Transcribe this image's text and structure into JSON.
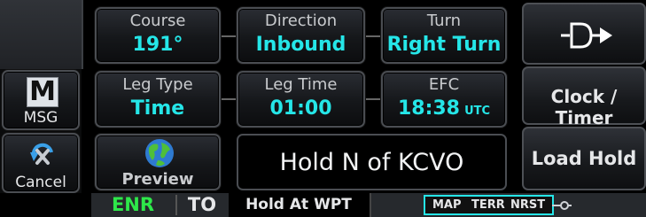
{
  "left_keys": {
    "msg": {
      "icon_letter": "M",
      "label": "MSG"
    },
    "cancel": {
      "label": "Cancel"
    }
  },
  "course": {
    "label": "Course",
    "value": "191°"
  },
  "direction": {
    "label": "Direction",
    "value": "Inbound"
  },
  "turn": {
    "label": "Turn",
    "value": "Right Turn"
  },
  "leg_type": {
    "label": "Leg Type",
    "value": "Time"
  },
  "leg_time": {
    "label": "Leg Time",
    "value": "01:00"
  },
  "efc": {
    "label": "EFC",
    "value": "18:38",
    "unit": "UTC"
  },
  "preview": {
    "label": "Preview"
  },
  "hold_display": {
    "text": "Hold N of KCVO"
  },
  "right_keys": {
    "clock_timer": "Clock / Timer",
    "load_hold": "Load Hold"
  },
  "status_bar": {
    "phase": "ENR",
    "to": "TO",
    "hold_at": "Hold At WPT",
    "map": "MAP",
    "terr": "TERR",
    "nrst": "NRST"
  },
  "colors": {
    "accent_cyan": "#25e6e8",
    "phase_green": "#2ee84a"
  }
}
